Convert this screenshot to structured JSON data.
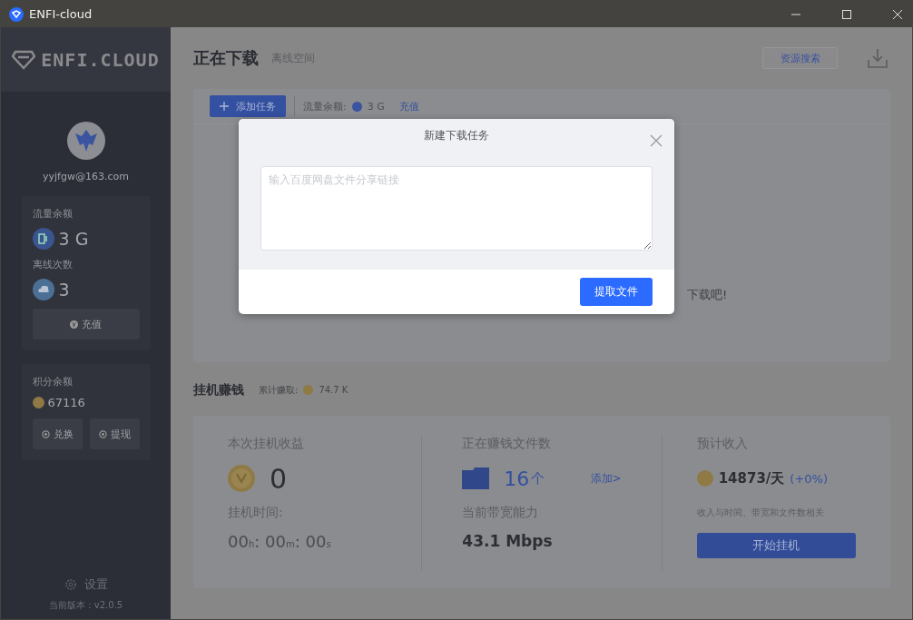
{
  "window": {
    "title": "ENFI-cloud"
  },
  "sidebar": {
    "logo": "ENFI.CLOUD",
    "user": "yyjfgw@163.com",
    "traffic": {
      "label": "流量余额",
      "value": "3 G"
    },
    "offline": {
      "label": "离线次数",
      "value": "3"
    },
    "recharge_button": "充值",
    "points": {
      "label": "积分余额",
      "value": "67116"
    },
    "points_buttons": [
      "兑换",
      "提现"
    ],
    "settings": "设置",
    "version": "当前版本：v2.0.5"
  },
  "tabs": [
    {
      "label": "正在下载",
      "selected": true
    },
    {
      "label": "离线空间",
      "selected": false
    }
  ],
  "resource_search_button": "资源搜索",
  "toolbar": {
    "add_button": "添加任务",
    "traffic_label": "流量余额:",
    "traffic_value": "3 G",
    "recharge_link": "充值"
  },
  "empty_hint": "下载吧!",
  "earning": {
    "title": "挂机赚钱",
    "total_label": "累计赚取:",
    "total_value": "74.7 K",
    "session": {
      "label": "本次挂机收益",
      "value": "0",
      "time_label": "挂机时间:",
      "time": "00$_{h}$:  00$_{m}$:  00$_{s}$"
    },
    "files": {
      "label": "正在赚钱文件数",
      "count": "16",
      "unit": "个",
      "add_link": "添加>",
      "bandwidth_label": "当前带宽能力",
      "bandwidth": "43.1 Mbps"
    },
    "forecast": {
      "label": "预计收入",
      "value": "14873/天",
      "change": "(+0%)",
      "note": "收入与时间、带宽和文件数相关",
      "start_button": "开始挂机"
    }
  },
  "modal": {
    "title": "新建下载任务",
    "placeholder": "输入百度网盘文件分享链接",
    "submit_button": "提取文件"
  }
}
